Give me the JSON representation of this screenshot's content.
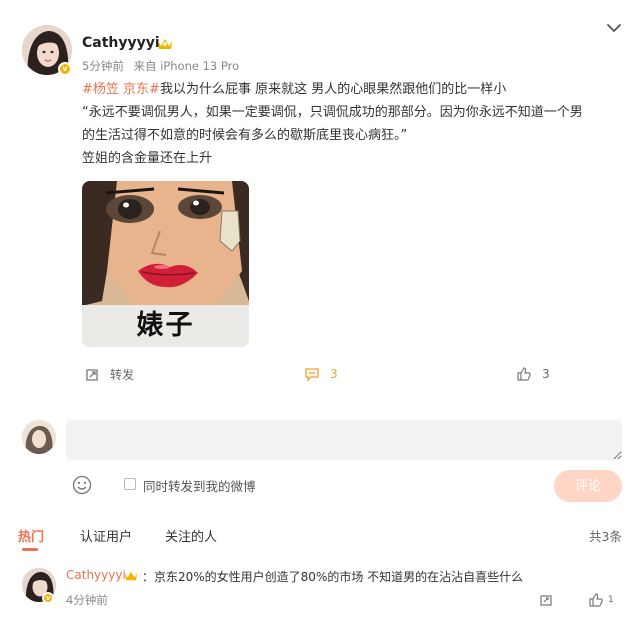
{
  "post": {
    "username": "Cathyyyyi",
    "time": "5分钟前",
    "source": "来自 iPhone 13 Pro",
    "tags": [
      "#杨笠",
      "京东#"
    ],
    "line1_rest": "我以为什么屁事 原来就这 男人的心眼果然跟他们的比一样小",
    "line2": "“永远不要调侃男人，如果一定要调侃，只调侃成功的那部分。因为你永远不知道一个男",
    "line3": "的生活过得不如意的时候会有多么的歇斯底里丧心病狂。”",
    "line4": "笠姐的含金量还在上升",
    "image_caption": "婊子"
  },
  "actions": {
    "repost_label": "转发",
    "comment_count": "3",
    "like_count": "3"
  },
  "composer": {
    "placeholder": "",
    "repost_option": "同时转发到我的微博",
    "submit_label": "评论"
  },
  "tabs": {
    "items": [
      "热门",
      "认证用户",
      "关注的人"
    ],
    "total": "共3条"
  },
  "reply": {
    "username": "Cathyyyyi",
    "text": "：京东20%的女性用户创造了80%的市场 不知道男的在沾沾自喜些什么",
    "time": "4分钟前",
    "like_count": "1"
  },
  "colors": {
    "accent": "#eb7350",
    "submit_disabled": "#ffd5c5",
    "input_bg": "#f2f3f5",
    "vip_gold": "#f5b400"
  },
  "icons": [
    "chevron-down-icon",
    "crown-icon",
    "repost-icon",
    "comment-icon",
    "like-icon",
    "emoji-icon",
    "share-icon"
  ]
}
